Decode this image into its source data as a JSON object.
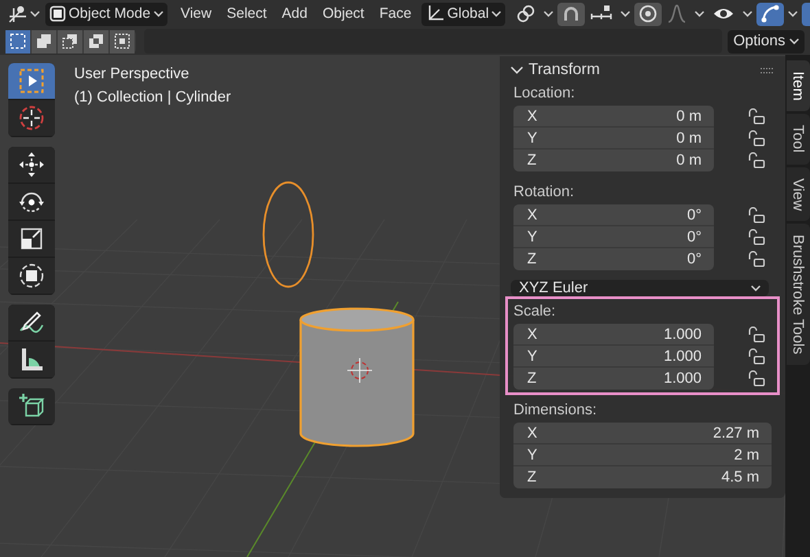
{
  "header": {
    "mode": "Object Mode",
    "menus": [
      "View",
      "Select",
      "Add",
      "Object",
      "Face"
    ],
    "orientation": "Global",
    "toggles": [
      {
        "kind": "pivot",
        "selected": false
      },
      {
        "kind": "snap",
        "selected": true
      },
      {
        "kind": "snap_target",
        "selected": false
      },
      {
        "kind": "proportional",
        "selected": true
      },
      {
        "kind": "falloff",
        "selected": false
      },
      {
        "kind": "visibility",
        "selected": false
      },
      {
        "kind": "gizmo",
        "selected": true
      }
    ]
  },
  "select_modes": [
    {
      "kind": "new",
      "selected": true
    },
    {
      "kind": "extend",
      "selected": false
    },
    {
      "kind": "subtract",
      "selected": false
    },
    {
      "kind": "difference",
      "selected": false
    },
    {
      "kind": "intersect",
      "selected": false
    }
  ],
  "options": "Options",
  "viewport": {
    "title": "User Perspective",
    "subtitle": "(1) Collection | Cylinder"
  },
  "tool_groups": [
    [
      {
        "kind": "select_box",
        "selected": true
      },
      {
        "kind": "cursor",
        "selected": false
      }
    ],
    [
      {
        "kind": "move",
        "selected": false
      },
      {
        "kind": "rotate",
        "selected": false
      },
      {
        "kind": "scale",
        "selected": false
      },
      {
        "kind": "transform",
        "selected": false
      }
    ],
    [
      {
        "kind": "annotate",
        "selected": false
      },
      {
        "kind": "measure",
        "selected": false
      }
    ],
    [
      {
        "kind": "add_cube",
        "selected": false
      }
    ]
  ],
  "panel": {
    "title": "Transform",
    "expanded": true,
    "sections": [
      {
        "kind": "fields",
        "label": "Location:",
        "highlighted": false,
        "rows": [
          {
            "axis": "X",
            "value": "0 m",
            "locked": false
          },
          {
            "axis": "Y",
            "value": "0 m",
            "locked": false
          },
          {
            "axis": "Z",
            "value": "0 m",
            "locked": false
          }
        ]
      },
      {
        "kind": "fields",
        "label": "Rotation:",
        "highlighted": false,
        "rows": [
          {
            "axis": "X",
            "value": "0°",
            "locked": false
          },
          {
            "axis": "Y",
            "value": "0°",
            "locked": false
          },
          {
            "axis": "Z",
            "value": "0°",
            "locked": false
          }
        ]
      },
      {
        "kind": "dropdown",
        "value": "XYZ Euler"
      },
      {
        "kind": "fields",
        "label": "Scale:",
        "highlighted": true,
        "rows": [
          {
            "axis": "X",
            "value": "1.000",
            "locked": false
          },
          {
            "axis": "Y",
            "value": "1.000",
            "locked": false
          },
          {
            "axis": "Z",
            "value": "1.000",
            "locked": false
          }
        ]
      },
      {
        "kind": "fields",
        "label": "Dimensions:",
        "highlighted": false,
        "rows": [
          {
            "axis": "X",
            "value": "2.27 m"
          },
          {
            "axis": "Y",
            "value": "2 m"
          },
          {
            "axis": "Z",
            "value": "4.5 m"
          }
        ]
      }
    ]
  },
  "tabs": [
    {
      "label": "Item",
      "selected": true
    },
    {
      "label": "Tool",
      "selected": false
    },
    {
      "label": "View",
      "selected": false
    },
    {
      "label": "Brushstroke Tools",
      "selected": false
    }
  ]
}
